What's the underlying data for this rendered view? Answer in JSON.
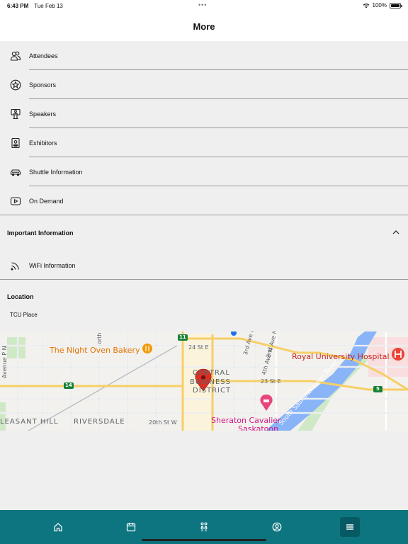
{
  "status_bar": {
    "time": "6:43 PM",
    "date": "Tue Feb 13",
    "battery": "100%"
  },
  "header": {
    "title": "More"
  },
  "menu": [
    {
      "label": "Attendees",
      "icon": "attendees-icon"
    },
    {
      "label": "Sponsors",
      "icon": "star-badge-icon"
    },
    {
      "label": "Speakers",
      "icon": "speaker-podium-icon"
    },
    {
      "label": "Exhibitors",
      "icon": "exhibitor-badge-icon"
    },
    {
      "label": "Shuttle Information",
      "icon": "car-icon"
    },
    {
      "label": "On Demand",
      "icon": "play-video-icon"
    }
  ],
  "important": {
    "title": "Important Information",
    "items": [
      {
        "label": "WiFi Information",
        "icon": "wifi-signal-icon"
      }
    ]
  },
  "location": {
    "title": "Location",
    "name": "TCU Place"
  },
  "map": {
    "labels": {
      "night_oven": "The Night Oven Bakery",
      "royal_hospital": "Royal University Hospital",
      "central": "CENTRAL",
      "business": "BUSINESS",
      "district": "DISTRICT",
      "sheraton": "Sheraton Cavalier",
      "saskatoon": "Saskatoon",
      "pleasant_hill": "LEASANT HILL",
      "riversdale": "RIVERSDALE",
      "twentieth": "20th St W",
      "st24": "24 St E",
      "st23": "23 St E",
      "ave3": "3rd Ave N",
      "ave4": "4th Ave N",
      "ave2": "2nd Ave N",
      "avep": "Avenue P N",
      "river": "South Saskatchewan River",
      "hw14": "14",
      "hw11": "11",
      "hw5": "5",
      "north": "orth"
    }
  },
  "tabs": [
    {
      "name": "home",
      "icon": "home-icon"
    },
    {
      "name": "schedule",
      "icon": "calendar-icon"
    },
    {
      "name": "people",
      "icon": "people-icon"
    },
    {
      "name": "profile",
      "icon": "profile-icon"
    },
    {
      "name": "more",
      "icon": "menu-icon"
    }
  ],
  "colors": {
    "tab_bar": "#0d7580",
    "tab_active": "#075a63",
    "map_pin": "#d93025"
  }
}
